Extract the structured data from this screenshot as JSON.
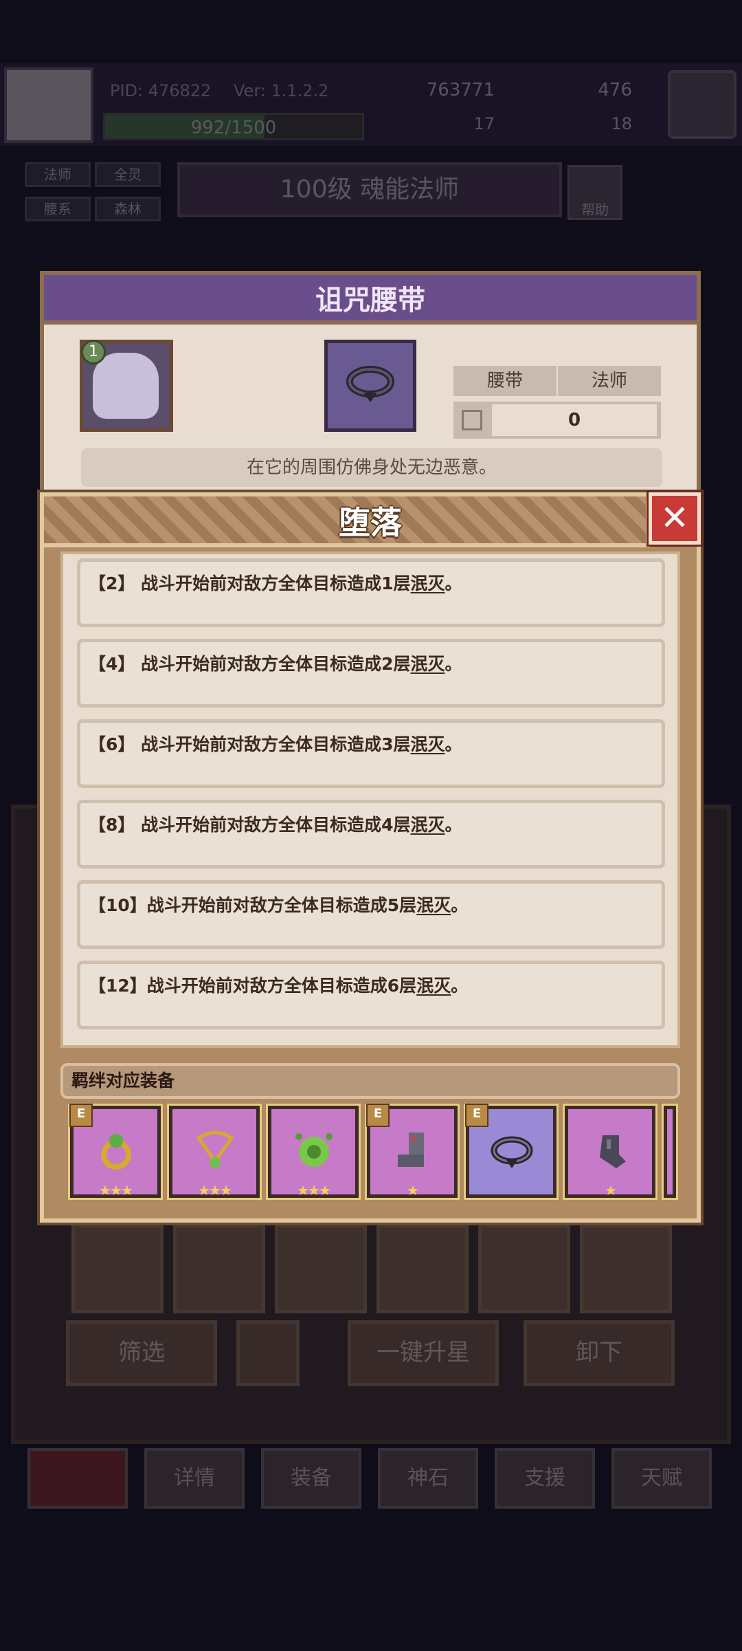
{
  "topbar": {
    "pid": "PID: 476822",
    "version": "Ver: 1.1.2.2",
    "gold": "763771",
    "gems": "476",
    "xp": "992/1500",
    "clover": "17",
    "shards": "18"
  },
  "hero": {
    "tags": [
      "法师",
      "全灵",
      "腰系",
      "森林"
    ],
    "level_title": "100级 魂能法师",
    "help_label": "帮助"
  },
  "item_card": {
    "title": "诅咒腰带",
    "character_badge": "1",
    "type_tag": "腰带",
    "class_tag": "法师",
    "value": "0",
    "description": "在它的周围仿佛身处无边恶意。"
  },
  "modal": {
    "title": "堕落",
    "close_icon": "close-icon",
    "entries": [
      {
        "prefix": "【2】 战斗开始前对敌方全体目标造成1层",
        "keyword": "泯灭",
        "suffix": "。"
      },
      {
        "prefix": "【4】 战斗开始前对敌方全体目标造成2层",
        "keyword": "泯灭",
        "suffix": "。"
      },
      {
        "prefix": "【6】 战斗开始前对敌方全体目标造成3层",
        "keyword": "泯灭",
        "suffix": "。"
      },
      {
        "prefix": "【8】 战斗开始前对敌方全体目标造成4层",
        "keyword": "泯灭",
        "suffix": "。"
      },
      {
        "prefix": "【10】战斗开始前对敌方全体目标造成5层",
        "keyword": "泯灭",
        "suffix": "。"
      },
      {
        "prefix": "【12】战斗开始前对敌方全体目标造成6层",
        "keyword": "泯灭",
        "suffix": "。"
      }
    ],
    "bond_label": "羁绊对应装备",
    "equipment": [
      {
        "icon": "gold-ring-icon",
        "badge": "E",
        "stars": "★★★"
      },
      {
        "icon": "heart-necklace-icon",
        "badge": "",
        "stars": "★★★"
      },
      {
        "icon": "green-gem-icon",
        "badge": "",
        "stars": "★★★"
      },
      {
        "icon": "iron-boots-icon",
        "badge": "E",
        "stars": "★"
      },
      {
        "icon": "cursed-belt-icon",
        "badge": "E",
        "stars": ""
      },
      {
        "icon": "iron-glove-icon",
        "badge": "",
        "stars": "★"
      },
      {
        "icon": "partial-item-icon",
        "badge": "",
        "stars": ""
      }
    ]
  },
  "bottom": {
    "filter_label": "筛选",
    "upstar_label": "一键升星",
    "unequip_label": "卸下",
    "nav": [
      "详情",
      "装备",
      "神石",
      "支援",
      "天赋"
    ]
  },
  "colors": {
    "modal_frame": "#b08a62",
    "close_red": "#c83a36",
    "equip_purple": "#c67ac8",
    "card_header": "#6a4e8c"
  }
}
